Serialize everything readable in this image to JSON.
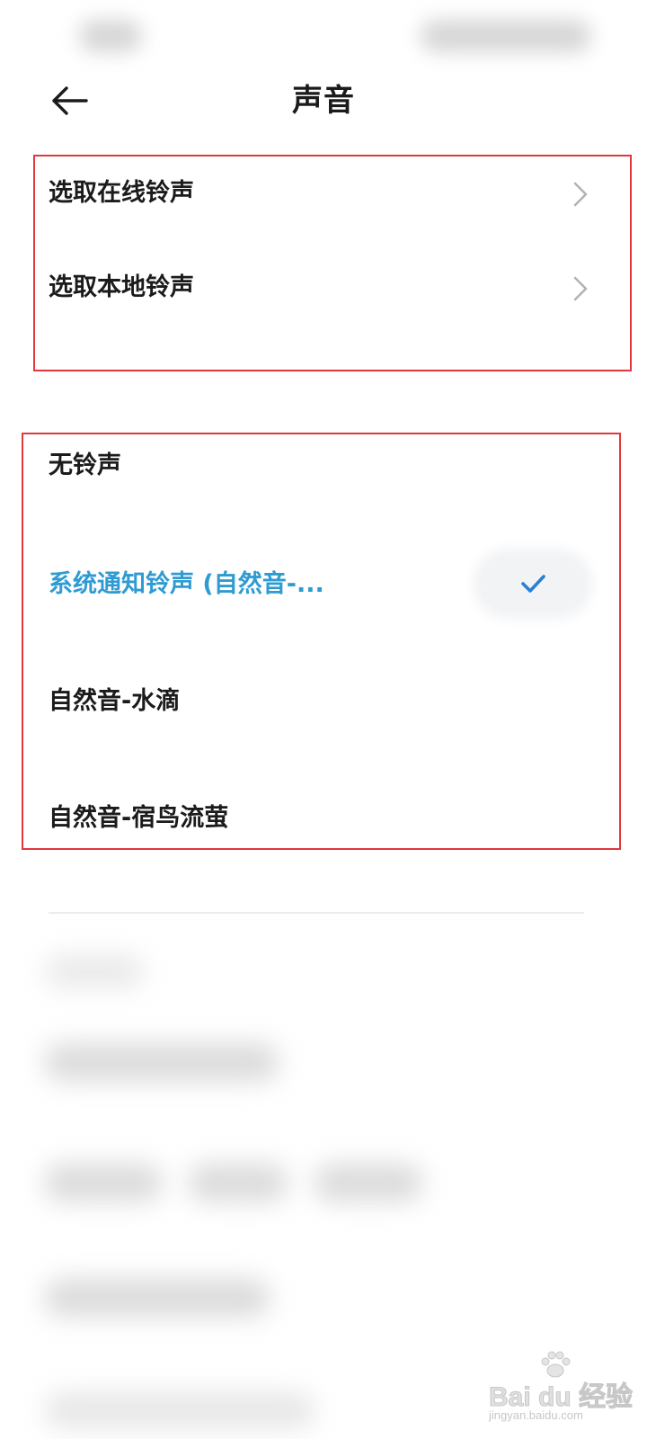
{
  "header": {
    "title": "声音",
    "back_icon": "arrow-left-icon"
  },
  "online_section": {
    "items": [
      {
        "label": "选取在线铃声",
        "icon": "chevron-right-icon"
      },
      {
        "label": "选取本地铃声",
        "icon": "chevron-right-icon"
      }
    ]
  },
  "ringtone_list": {
    "selected_color": "#2f9bd3",
    "items": [
      {
        "label": "无铃声",
        "selected": false
      },
      {
        "label": "系统通知铃声 (自然音-...",
        "selected": true,
        "icon": "checkmark-icon"
      },
      {
        "label": "自然音-水滴",
        "selected": false
      },
      {
        "label": "自然音-宿鸟流萤",
        "selected": false
      }
    ]
  },
  "annotation_color": "#e0383e",
  "watermark": {
    "logo_text": "Bai du 经验",
    "url": "jingyan.baidu.com"
  }
}
